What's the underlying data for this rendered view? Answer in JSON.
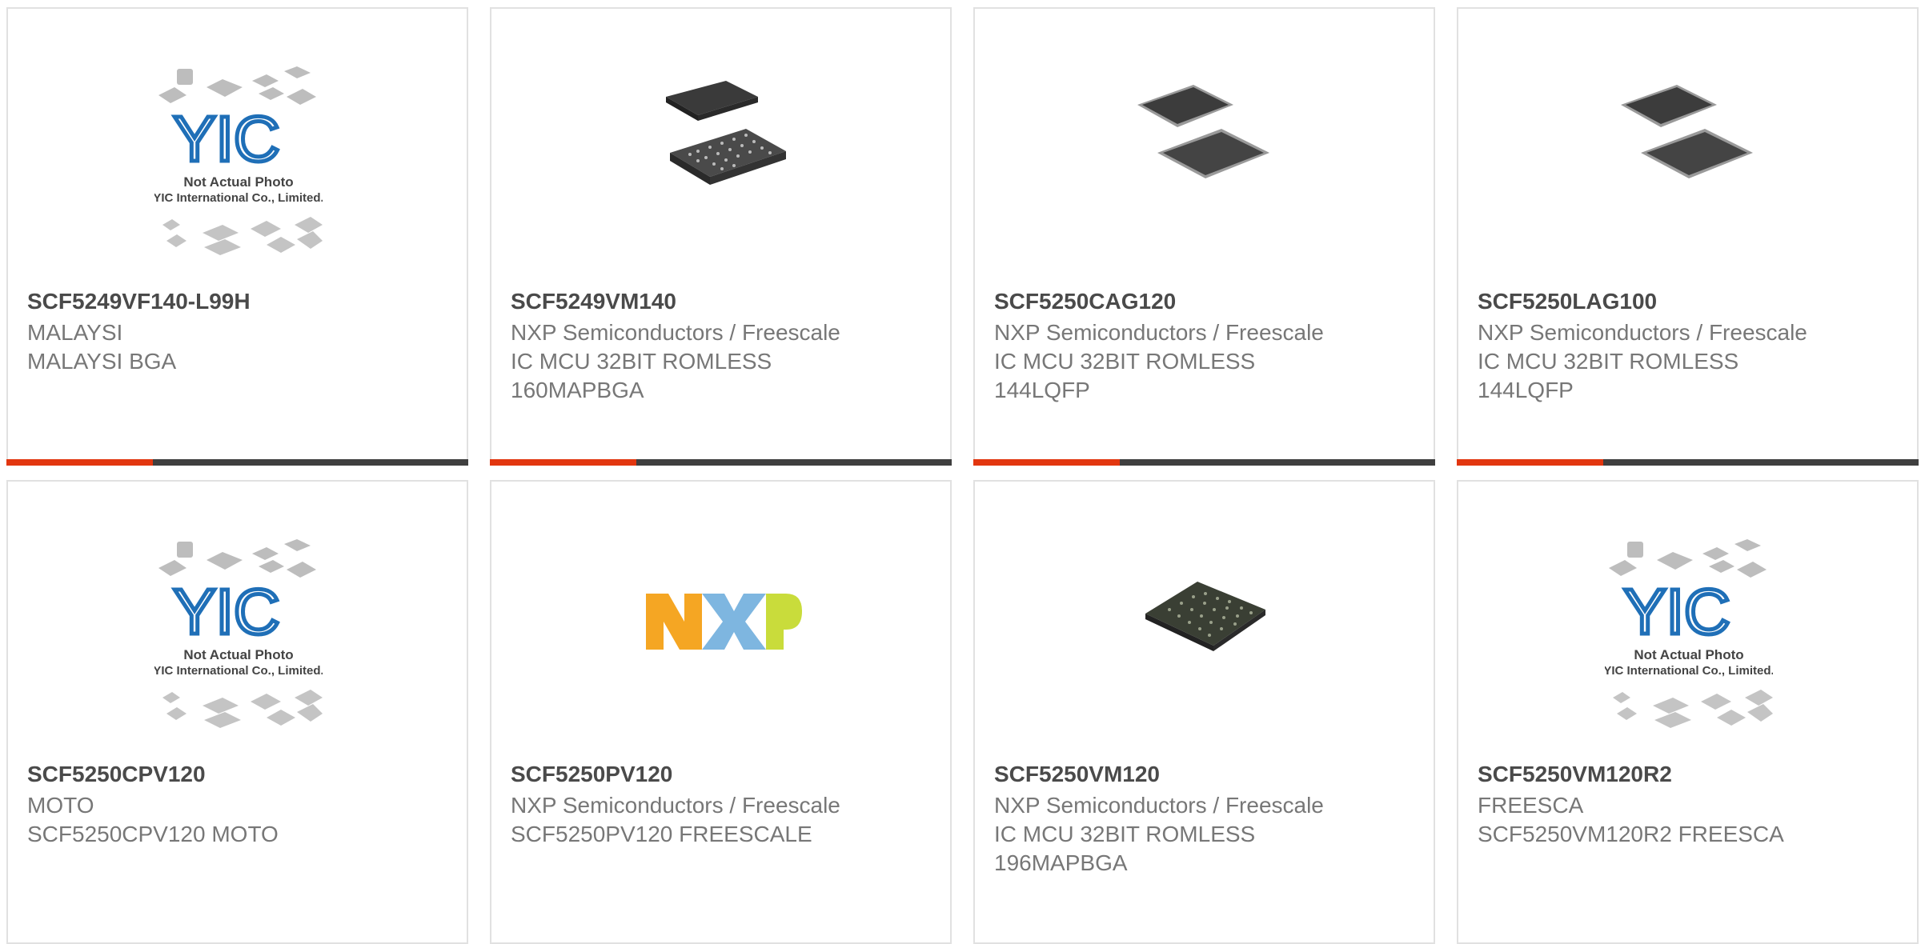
{
  "products": [
    {
      "part": "SCF5249VF140-L99H",
      "line1": "MALAYSI",
      "line2": "MALAYSI BGA",
      "line3": "",
      "image": "yic-placeholder",
      "photo_text1": "Not Actual Photo",
      "photo_text2": "YIC International Co., Limited."
    },
    {
      "part": "SCF5249VM140",
      "line1": "NXP Semiconductors / Freescale",
      "line2": "IC MCU 32BIT ROMLESS",
      "line3": "160MAPBGA",
      "image": "bga-chip"
    },
    {
      "part": "SCF5250CAG120",
      "line1": "NXP Semiconductors / Freescale",
      "line2": "IC MCU 32BIT ROMLESS",
      "line3": "144LQFP",
      "image": "lqfp-chip"
    },
    {
      "part": "SCF5250LAG100",
      "line1": "NXP Semiconductors / Freescale",
      "line2": "IC MCU 32BIT ROMLESS",
      "line3": "144LQFP",
      "image": "lqfp-chip"
    },
    {
      "part": "SCF5250CPV120",
      "line1": "MOTO",
      "line2": "SCF5250CPV120 MOTO",
      "line3": "",
      "image": "yic-placeholder",
      "photo_text1": "Not Actual Photo",
      "photo_text2": "YIC International Co., Limited."
    },
    {
      "part": "SCF5250PV120",
      "line1": "NXP Semiconductors / Freescale",
      "line2": "SCF5250PV120 FREESCALE",
      "line3": "",
      "image": "nxp-logo",
      "logo_text": "NXP"
    },
    {
      "part": "SCF5250VM120",
      "line1": "NXP Semiconductors / Freescale",
      "line2": "IC MCU 32BIT ROMLESS",
      "line3": "196MAPBGA",
      "image": "bga-chip"
    },
    {
      "part": "SCF5250VM120R2",
      "line1": "FREESCA",
      "line2": "SCF5250VM120R2 FREESCA",
      "line3": "",
      "image": "yic-placeholder",
      "photo_text1": "Not Actual Photo",
      "photo_text2": "YIC International Co., Limited."
    }
  ],
  "colors": {
    "accent": "#e2360f",
    "bar": "#3f3f3f",
    "title": "#4a4a4a",
    "text": "#777777",
    "border": "#e1e1e1",
    "yic_blue": "#1f6fb7"
  }
}
